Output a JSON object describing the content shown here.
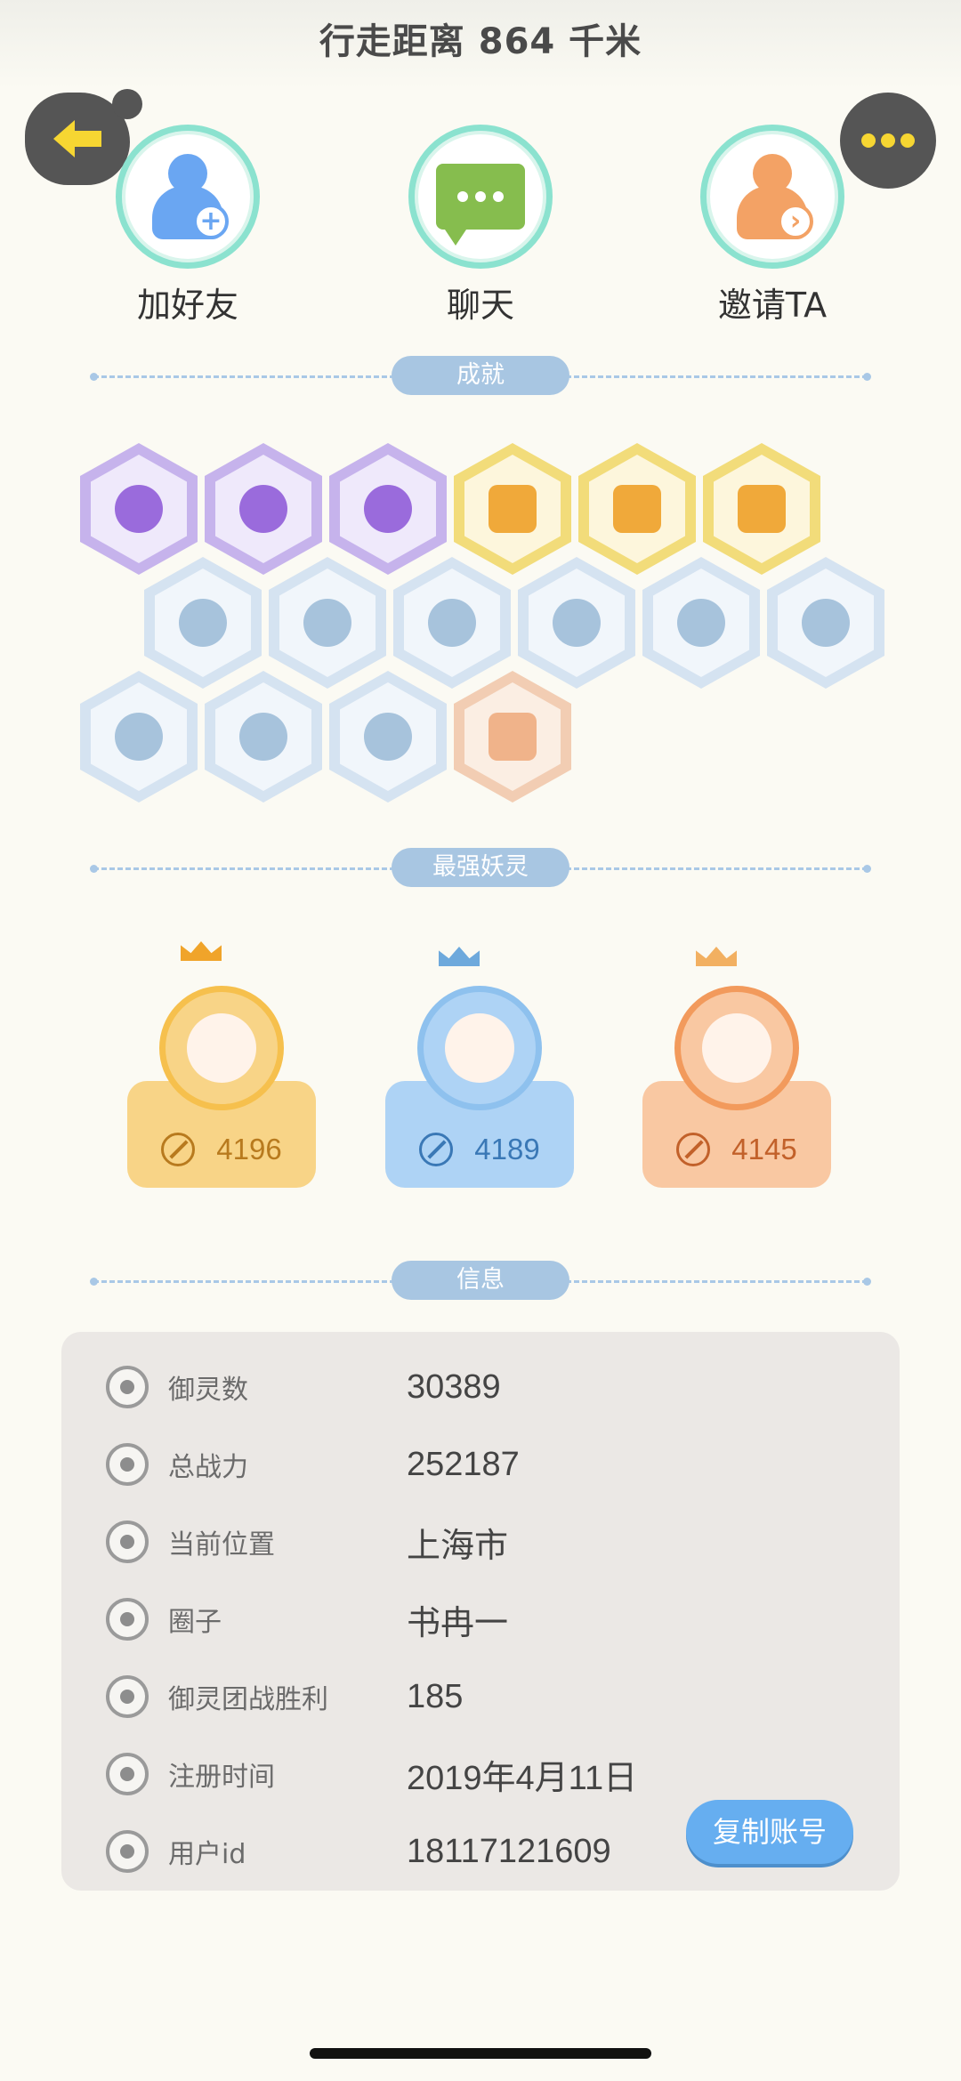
{
  "header": {
    "title": "行走距离 864 千米"
  },
  "actions": [
    {
      "label": "加好友",
      "icon": "add-friend-icon"
    },
    {
      "label": "聊天",
      "icon": "chat-icon"
    },
    {
      "label": "邀请TA",
      "icon": "invite-icon"
    }
  ],
  "sections": {
    "achievements": "成就",
    "strongest": "最强妖灵",
    "info": "信息"
  },
  "achievements": [
    {
      "color": "purple"
    },
    {
      "color": "purple"
    },
    {
      "color": "purple"
    },
    {
      "color": "gold"
    },
    {
      "color": "gold"
    },
    {
      "color": "gold"
    },
    {
      "color": "blue"
    },
    {
      "color": "blue"
    },
    {
      "color": "blue"
    },
    {
      "color": "blue"
    },
    {
      "color": "blue"
    },
    {
      "color": "blue"
    },
    {
      "color": "blue"
    },
    {
      "color": "blue"
    },
    {
      "color": "blue"
    },
    {
      "color": "orange"
    }
  ],
  "spirits": [
    {
      "power": "4196",
      "card_color": "#f8d487",
      "text_color": "#b87a1e",
      "ring_color": "#f6c04d",
      "crown_color": "#f0a42a"
    },
    {
      "power": "4189",
      "card_color": "#aed3f5",
      "text_color": "#3a78b6",
      "ring_color": "#8ec1ee",
      "crown_color": "#6ea9dc"
    },
    {
      "power": "4145",
      "card_color": "#f9c8a2",
      "text_color": "#c2612a",
      "ring_color": "#f29a5c",
      "crown_color": "#f2b061"
    }
  ],
  "info": {
    "rows": [
      {
        "key": "御灵数",
        "value": "30389",
        "icon": "spirit-count-icon"
      },
      {
        "key": "总战力",
        "value": "252187",
        "icon": "power-icon"
      },
      {
        "key": "当前位置",
        "value": "上海市",
        "icon": "location-icon"
      },
      {
        "key": "圈子",
        "value": "书冉一",
        "icon": "circle-icon"
      },
      {
        "key": "御灵团战胜利",
        "value": "185",
        "icon": "team-battle-icon"
      },
      {
        "key": "注册时间",
        "value": "2019年4月11日",
        "icon": "clock-icon"
      },
      {
        "key": "用户id",
        "value": "18117121609",
        "icon": "user-id-icon"
      }
    ],
    "copy_button": "复制账号"
  }
}
